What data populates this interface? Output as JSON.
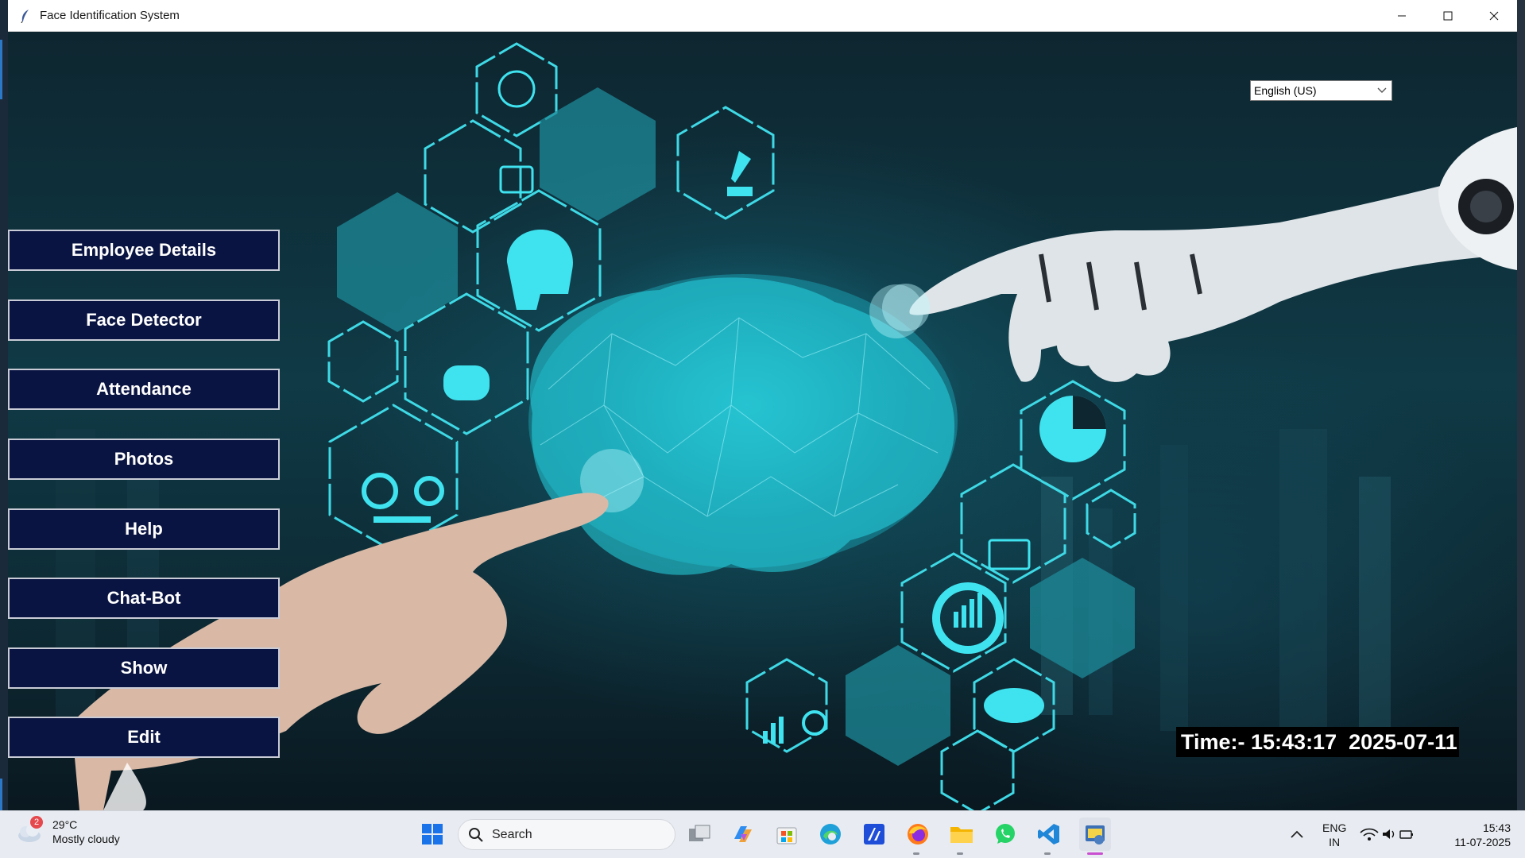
{
  "window": {
    "title": "Face Identification System",
    "controls": {
      "minimize": "minimize-icon",
      "maximize": "maximize-icon",
      "close": "close-icon"
    }
  },
  "sidebar": {
    "buttons": [
      {
        "label": "Employee Details"
      },
      {
        "label": "Face Detector"
      },
      {
        "label": "Attendance"
      },
      {
        "label": "Photos"
      },
      {
        "label": "Help"
      },
      {
        "label": "Chat-Bot"
      },
      {
        "label": "Show"
      },
      {
        "label": "Edit"
      }
    ],
    "button_bg": "#0a1442",
    "button_text_color": "#ffffff"
  },
  "language": {
    "selected": "English (US)"
  },
  "status": {
    "time_text": "Time:- 15:43:17  2025-07-11"
  },
  "background": {
    "description_colors": {
      "accent": "#22d3e0",
      "dark": "#0d2a34"
    }
  },
  "taskbar": {
    "weather": {
      "badge": "2",
      "temperature": "29°C",
      "condition": "Mostly cloudy"
    },
    "search": {
      "placeholder": "Search"
    },
    "apps": [
      "windows-start-icon",
      "task-view-icon",
      "copilot-icon",
      "store-icon",
      "edge-icon",
      "app-icon",
      "firefox-icon",
      "file-explorer-icon",
      "whatsapp-icon",
      "vscode-icon",
      "python-app-icon"
    ],
    "tray": {
      "language_top": "ENG",
      "language_bottom": "IN"
    },
    "clock": {
      "time": "15:43",
      "date": "11-07-2025"
    }
  }
}
